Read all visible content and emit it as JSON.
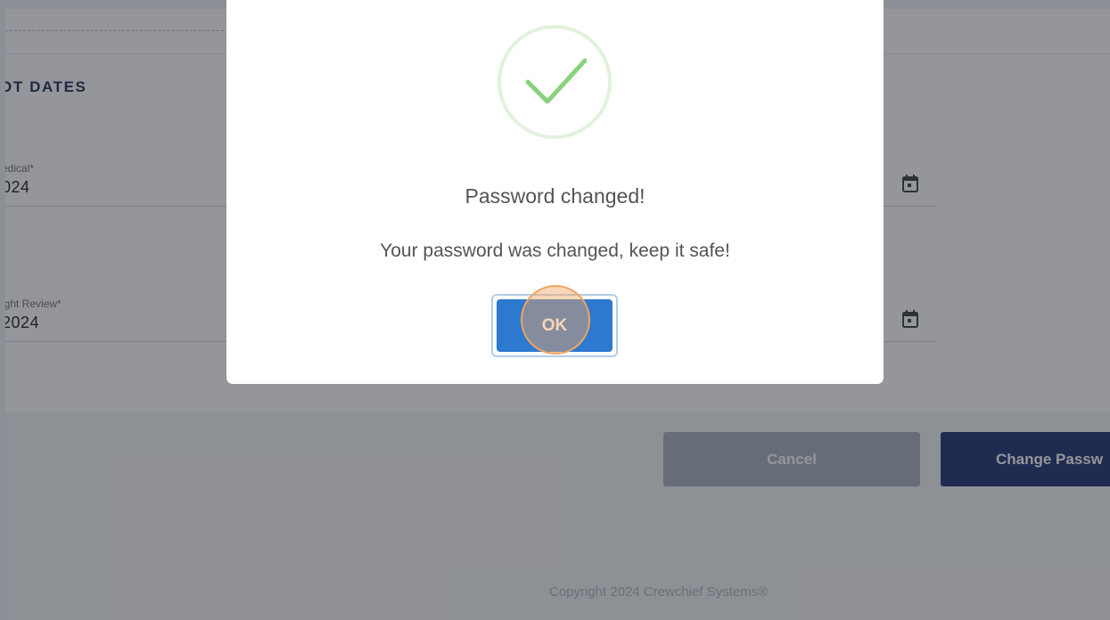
{
  "section": {
    "title": "OT DATES"
  },
  "fields": [
    {
      "label": "edical*",
      "value": "024"
    },
    {
      "label": "ight Review*",
      "value": "2024"
    }
  ],
  "footer": {
    "cancel_label": "Cancel",
    "change_password_label": "Change Passw",
    "copyright": "Copyright 2024 Crewchief Systems®"
  },
  "modal": {
    "title": "Password changed!",
    "message": "Your password was changed, keep it safe!",
    "ok_label": "OK"
  },
  "colors": {
    "success": "#8ad17e",
    "ok_button": "#2c79cf",
    "primary_button": "#1f3373",
    "click_highlight": "#f1a560"
  },
  "icons": [
    "success-check-icon",
    "calendar-icon"
  ]
}
